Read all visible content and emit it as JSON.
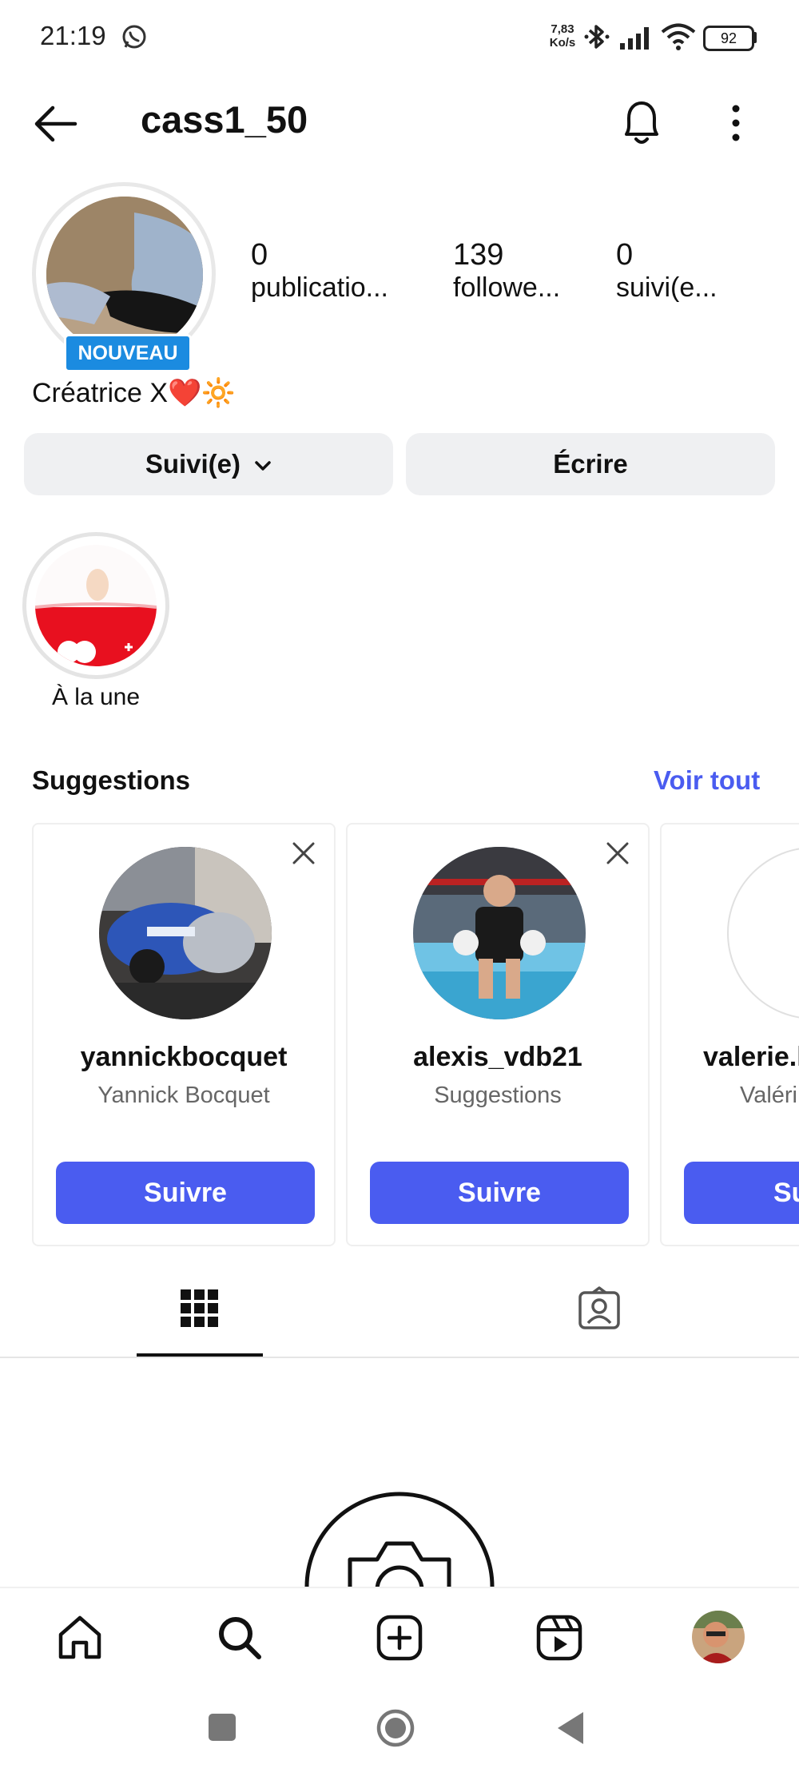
{
  "status_bar": {
    "time": "21:19",
    "net_speed_value": "7,83",
    "net_speed_unit": "Ko/s",
    "battery": "92"
  },
  "header": {
    "username": "cass1_50",
    "back_icon": "arrow-left-icon",
    "bell_icon": "bell-icon",
    "more_icon": "more-vertical-icon"
  },
  "profile": {
    "new_badge": "NOUVEAU",
    "stats": [
      {
        "value": "0",
        "label": "publicatio..."
      },
      {
        "value": "139",
        "label": "followe..."
      },
      {
        "value": "0",
        "label": "suivi(e..."
      }
    ],
    "bio": "Créatrice X❤️🔆"
  },
  "actions": {
    "following_label": "Suivi(e)",
    "message_label": "Écrire"
  },
  "highlights": [
    {
      "label": "À la une"
    }
  ],
  "suggestions": {
    "title": "Suggestions",
    "see_all": "Voir tout",
    "cards": [
      {
        "username": "yannickbocquet",
        "subtitle": "Yannick Bocquet",
        "button": "Suivre"
      },
      {
        "username": "alexis_vdb21",
        "subtitle": "Suggestions",
        "button": "Suivre"
      },
      {
        "username": "valerie.l",
        "subtitle": "Valéri",
        "button": "Su"
      }
    ]
  },
  "tabs": [
    "grid-icon",
    "tagged-icon"
  ],
  "bottom_nav": [
    "home-icon",
    "search-icon",
    "create-icon",
    "reels-icon",
    "profile-avatar"
  ],
  "system_nav": [
    "recents-button",
    "home-button",
    "back-button"
  ],
  "colors": {
    "accent": "#4a5cf0",
    "badge": "#1b8be0",
    "button_grey": "#eff0f2"
  }
}
